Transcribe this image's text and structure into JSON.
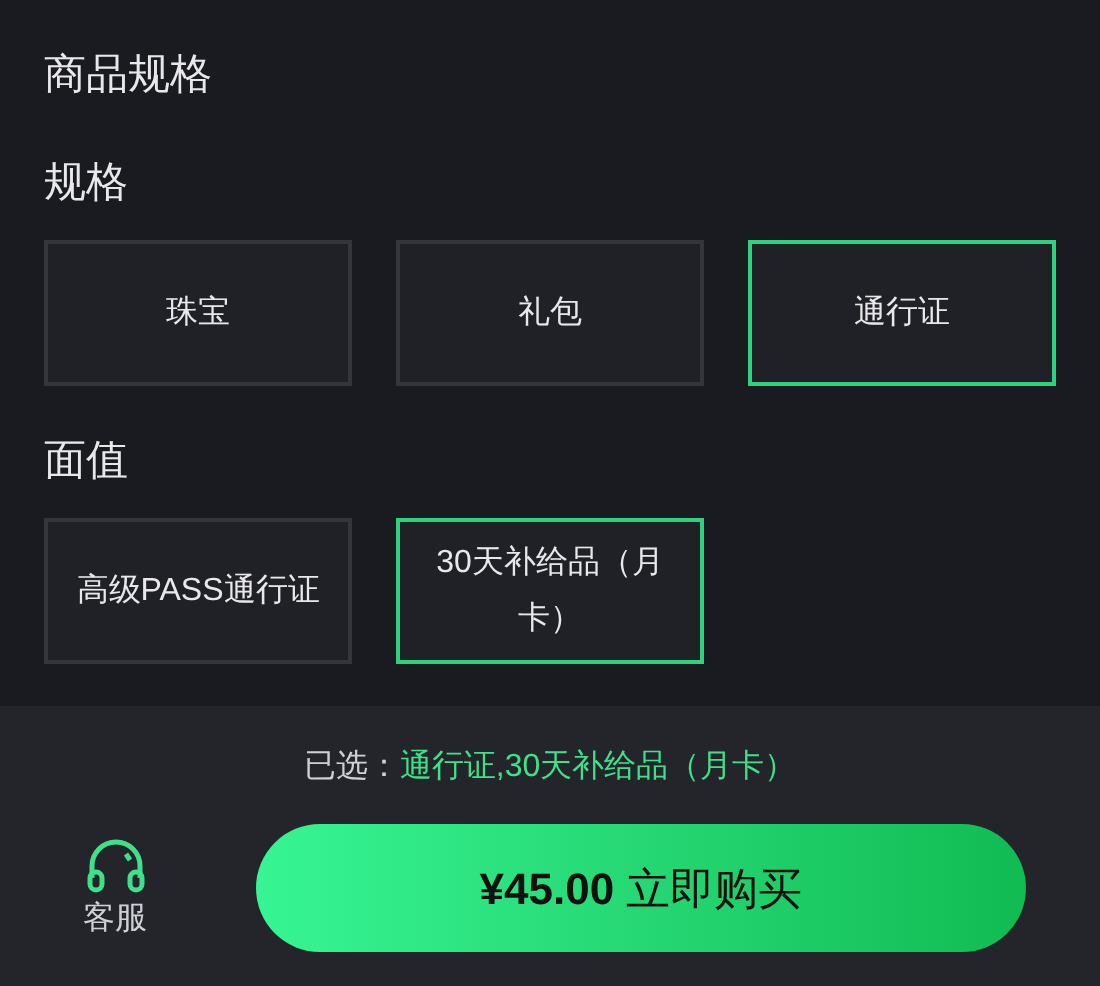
{
  "title": "商品规格",
  "groups": [
    {
      "label": "规格",
      "options": [
        {
          "label": "珠宝",
          "selected": false
        },
        {
          "label": "礼包",
          "selected": false
        },
        {
          "label": "通行证",
          "selected": true
        }
      ]
    },
    {
      "label": "面值",
      "options": [
        {
          "label": "高级PASS通行证",
          "selected": false
        },
        {
          "label": "30天补给品（月卡）",
          "selected": true
        }
      ]
    }
  ],
  "footer": {
    "selected_label": "已选：",
    "selected_value": "通行证,30天补给品（月卡）",
    "service_label": "客服",
    "buy_button": "**¥45.00** 立即购买"
  }
}
